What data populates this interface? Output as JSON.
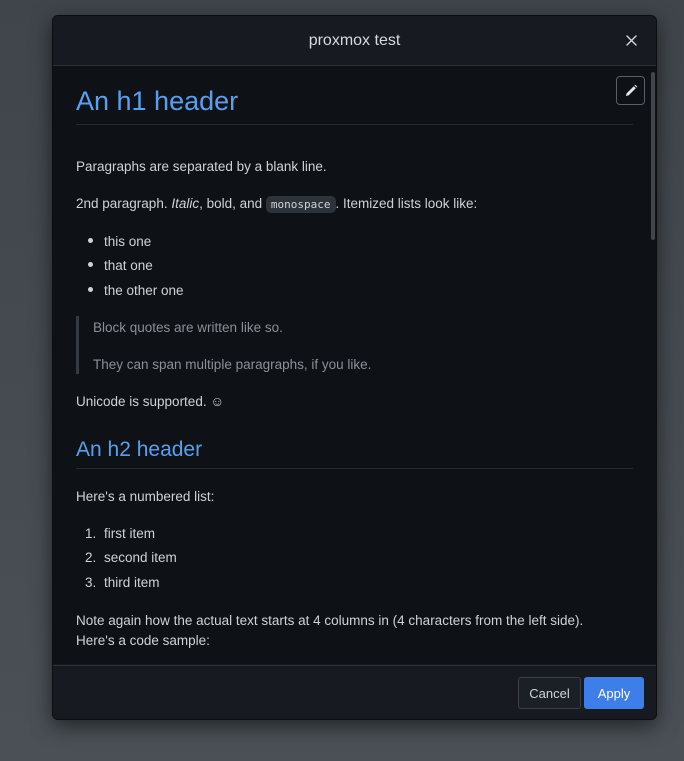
{
  "dialog": {
    "title": "proxmox test",
    "close_icon": "close-icon",
    "edit_icon": "pencil-icon"
  },
  "markdown": {
    "h1": "An h1 header",
    "p1": "Paragraphs are separated by a blank line.",
    "p2": {
      "before": "2nd paragraph. ",
      "italic": "Italic",
      "mid": ", bold, and ",
      "code": "monospace",
      "after": ". Itemized lists look like:"
    },
    "bullets": [
      "this one",
      "that one",
      "the other one"
    ],
    "blockquote": [
      "Block quotes are written like so.",
      "They can span multiple paragraphs, if you like."
    ],
    "unicode_text": "Unicode is supported. ☺",
    "h2": "An h2 header",
    "numbered_intro": "Here's a numbered list:",
    "numbered": [
      {
        "n": "1.",
        "text": "first item"
      },
      {
        "n": "2.",
        "text": "second item"
      },
      {
        "n": "3.",
        "text": "third item"
      }
    ],
    "note_line1": "Note again how the actual text starts at 4 columns in (4 characters from the left side).",
    "note_line2": "Here's a code sample:"
  },
  "footer": {
    "cancel_label": "Cancel",
    "apply_label": "Apply"
  },
  "colors": {
    "accent": "#3d7ee9",
    "heading": "#58a0ee",
    "dialog_bg": "#171b21",
    "content_bg": "#0e1116"
  }
}
